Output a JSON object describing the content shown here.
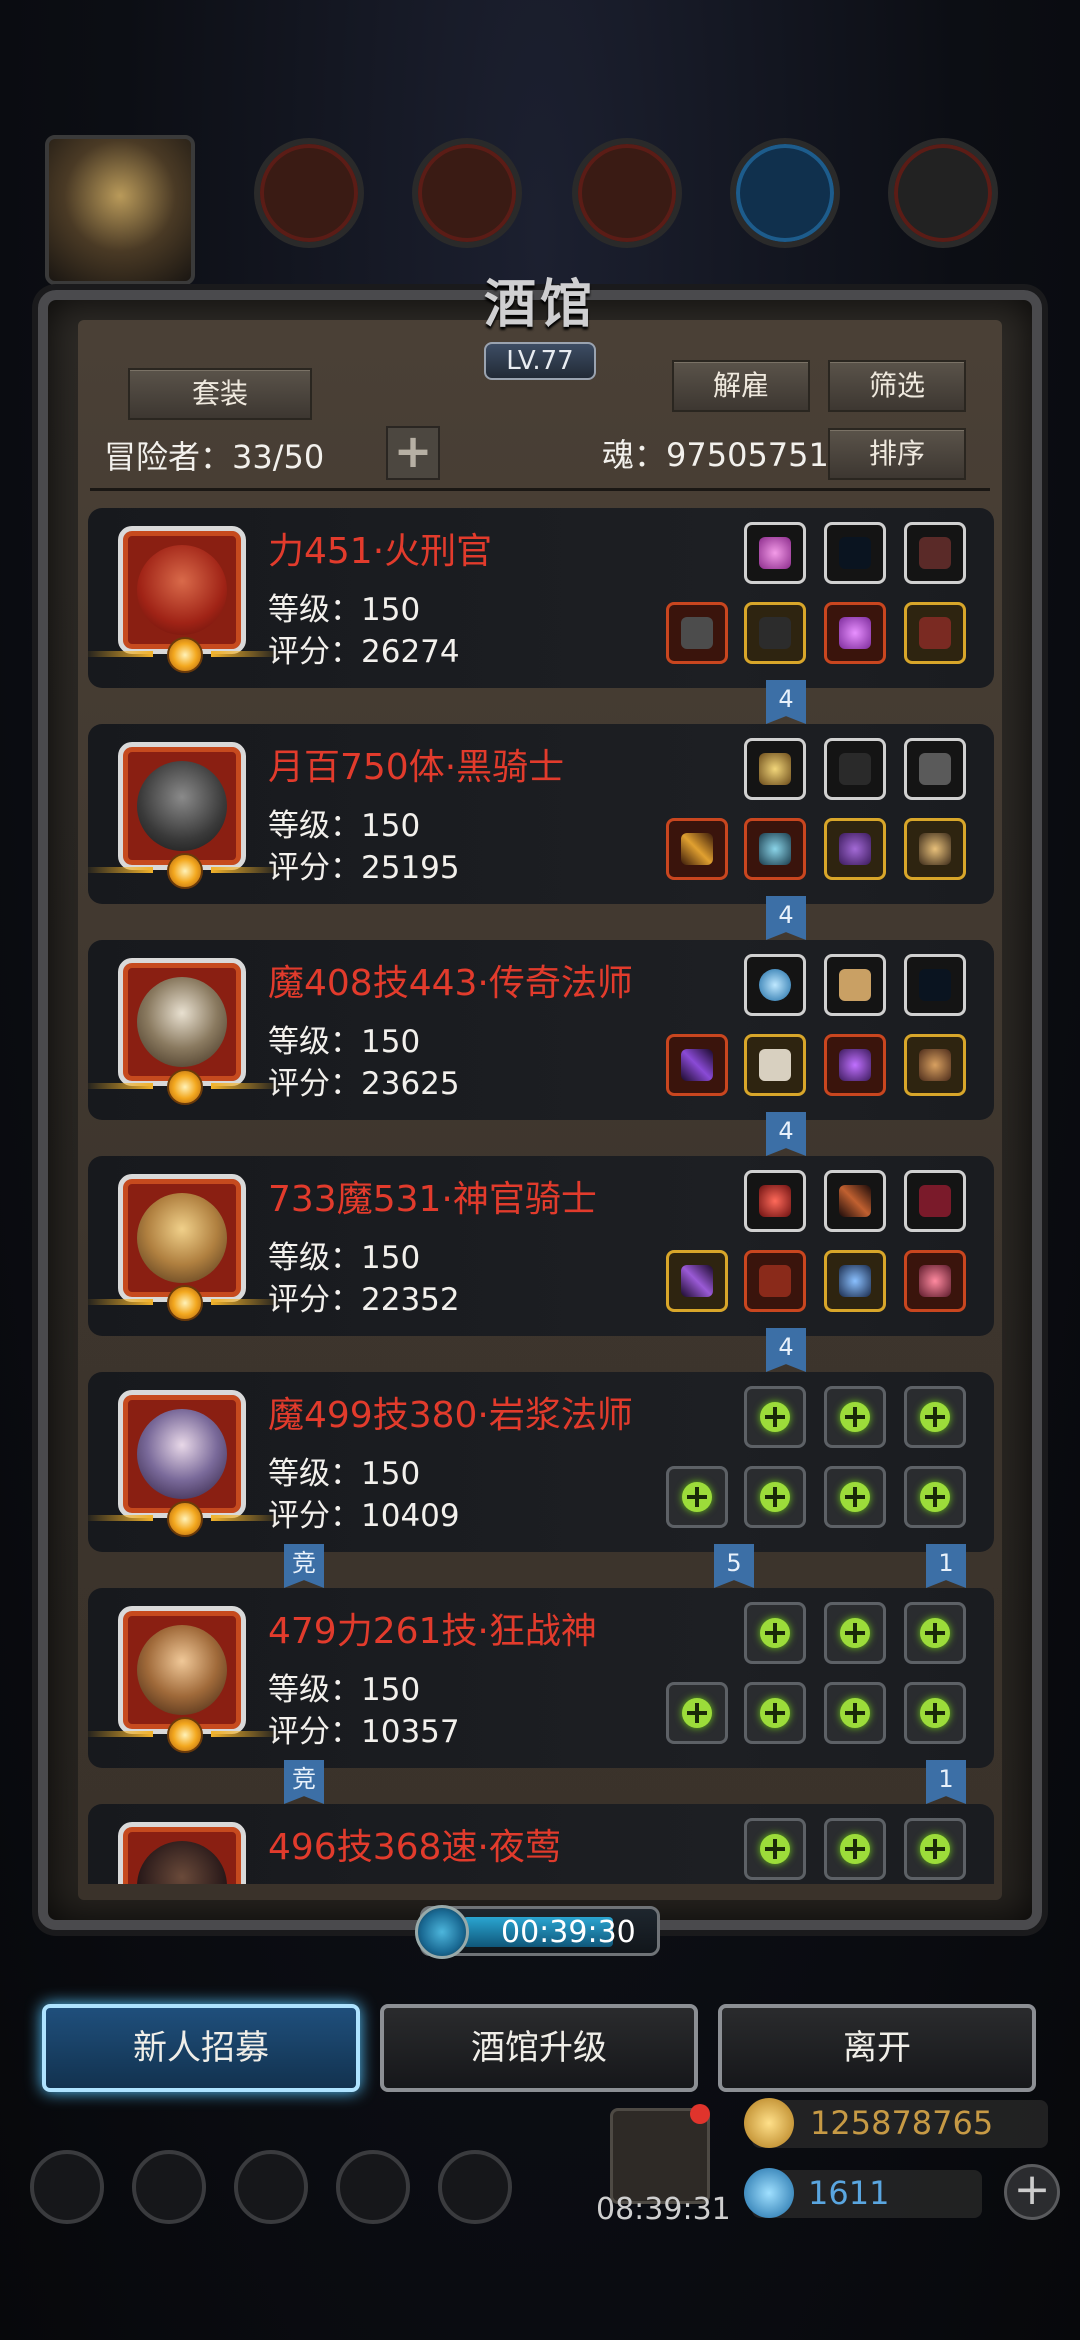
{
  "tavern": {
    "title": "酒馆",
    "level": "LV.77",
    "set_button": "套装",
    "adventurers_label": "冒险者：33/50",
    "add_button": "+",
    "dismiss_button": "解雇",
    "filter_button": "筛选",
    "soul_label": "魂：97505751",
    "sort_button": "排序"
  },
  "heroes": [
    {
      "name": "力451·火刑官",
      "level": "等级：150",
      "score": "评分：26274",
      "ribbon_mid": "4",
      "ribbon_left": "",
      "ribbon_right": ""
    },
    {
      "name": "月百750体·黑骑士",
      "level": "等级：150",
      "score": "评分：25195",
      "ribbon_mid": "4",
      "ribbon_left": "",
      "ribbon_right": ""
    },
    {
      "name": "魔408技443·传奇法师",
      "level": "等级：150",
      "score": "评分：23625",
      "ribbon_mid": "4",
      "ribbon_left": "",
      "ribbon_right": ""
    },
    {
      "name": "733魔531·神官骑士",
      "level": "等级：150",
      "score": "评分：22352",
      "ribbon_mid": "4",
      "ribbon_left": "",
      "ribbon_right": ""
    },
    {
      "name": "魔499技380·岩浆法师",
      "level": "等级：150",
      "score": "评分：10409",
      "ribbon_mid": "",
      "ribbon_left": "竞",
      "ribbon_right": "1",
      "ribbon_mid2": "5"
    },
    {
      "name": "479力261技·狂战神",
      "level": "等级：150",
      "score": "评分：10357",
      "ribbon_mid": "",
      "ribbon_left": "竞",
      "ribbon_right": "1"
    },
    {
      "name": "496技368速·夜莺",
      "level": "",
      "score": ""
    }
  ],
  "timer": "00:39:30",
  "actions": {
    "recruit": "新人招募",
    "upgrade": "酒馆升级",
    "leave": "离开"
  },
  "footer": {
    "chest_timer": "08:39:31",
    "gold": "125878765",
    "gems": "1611",
    "plus": "+"
  },
  "colors": {
    "hero_name": "#e23b2c",
    "accent_blue": "#57c6ff",
    "slot_plus": "#9cdc3a"
  }
}
